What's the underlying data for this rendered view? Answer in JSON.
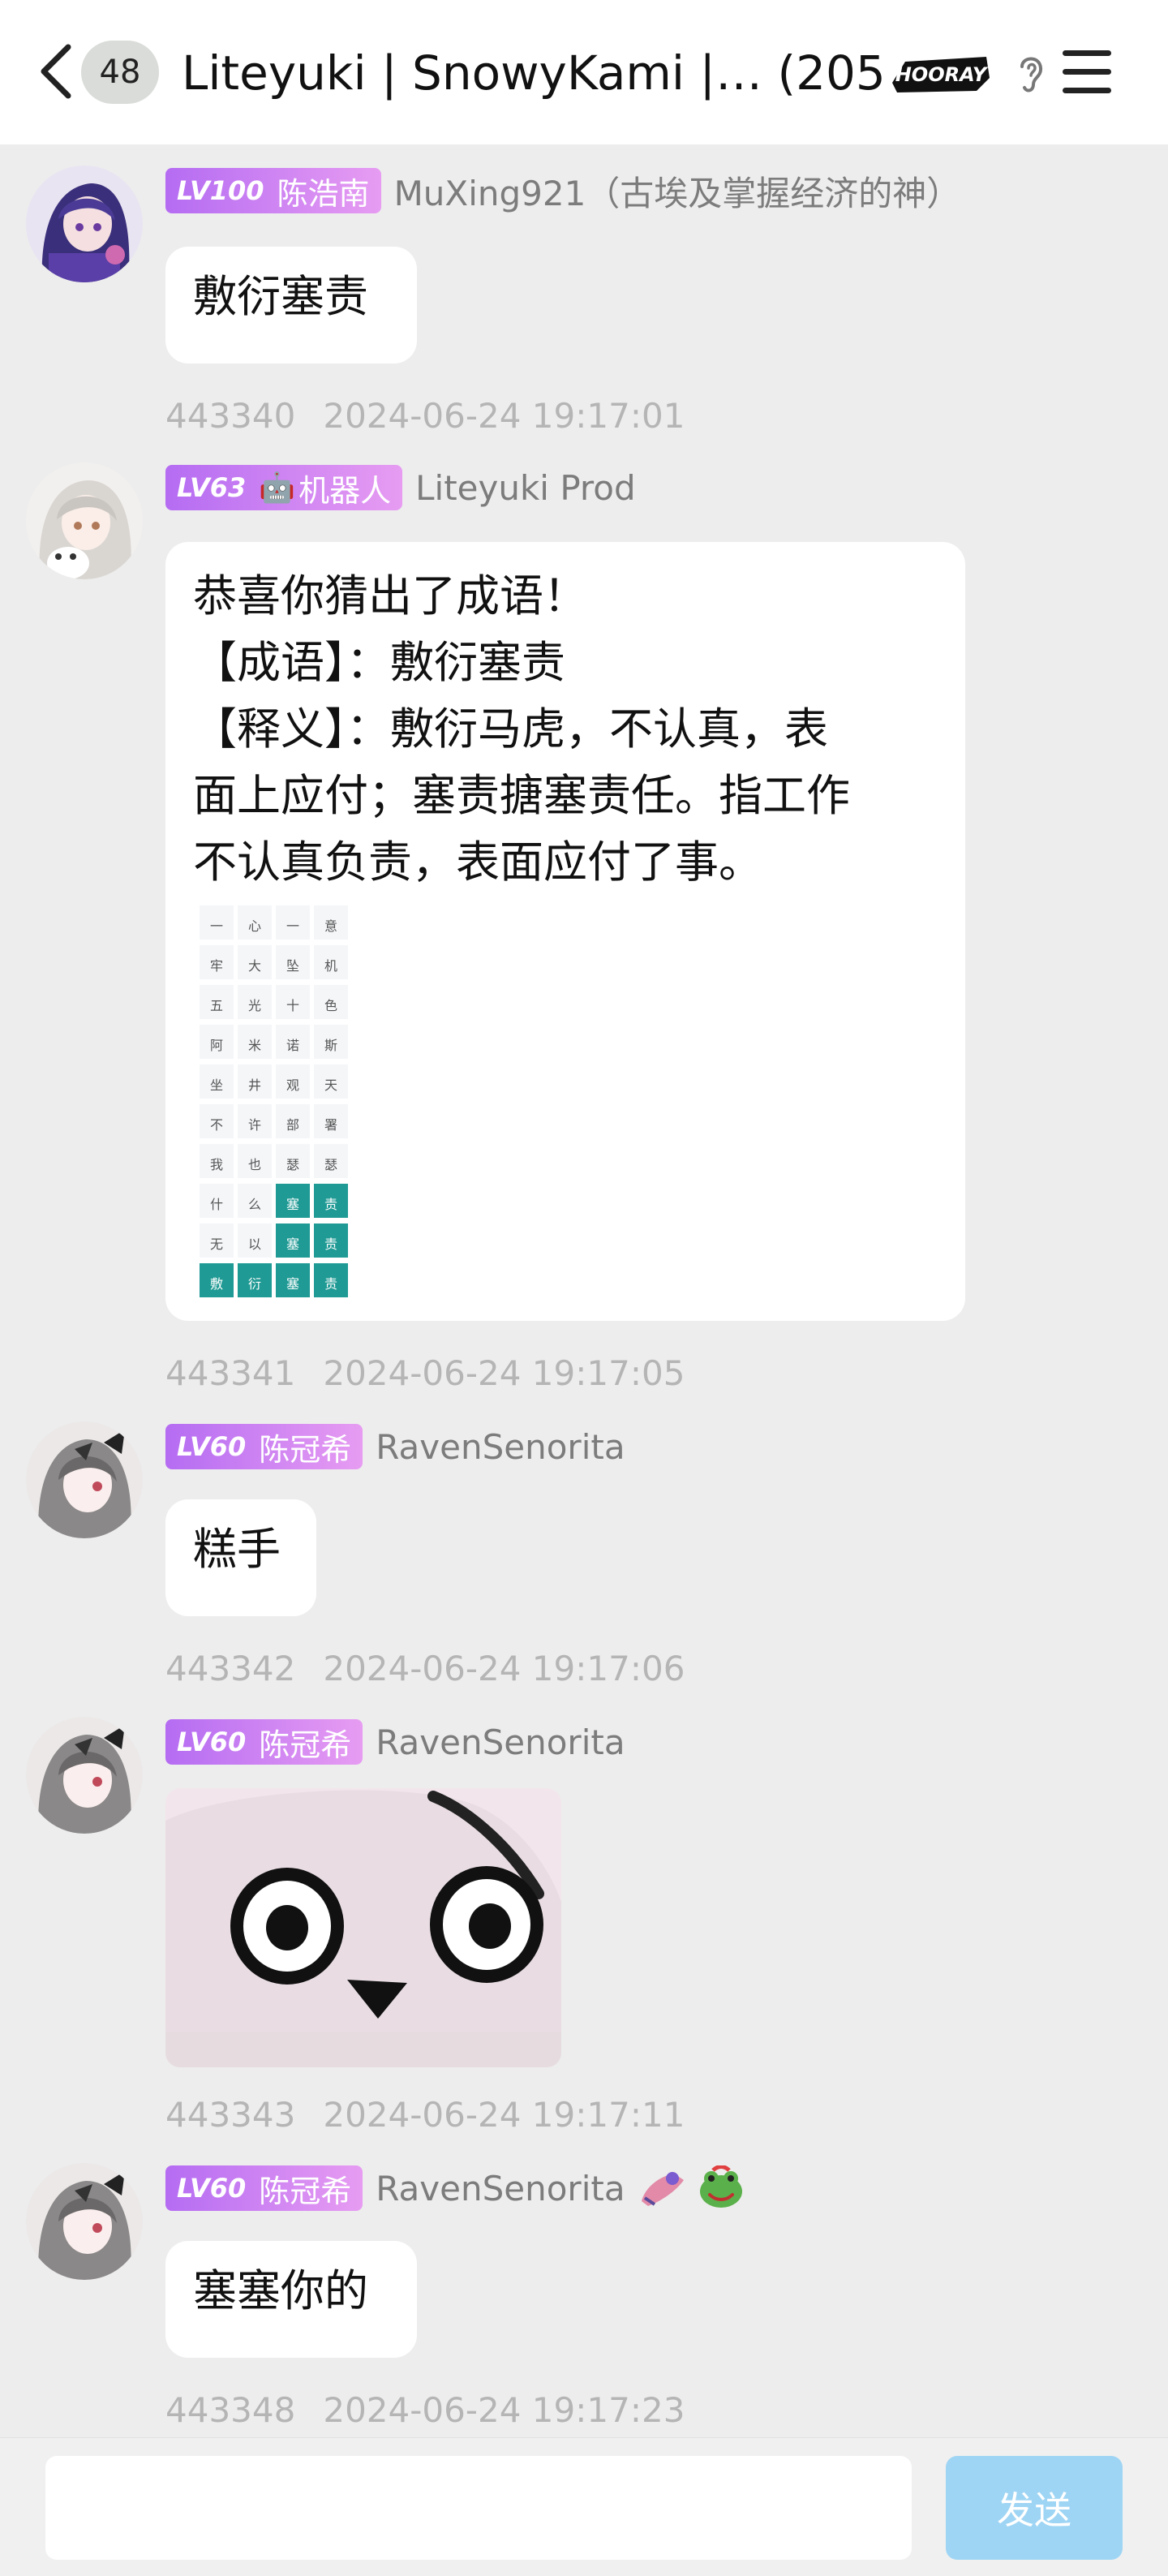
{
  "header": {
    "unread": "48",
    "title": "Liteyuki | SnowyKami |… (205)",
    "hooray_text": "HOORAY"
  },
  "messages": [
    {
      "level": "LV100",
      "badge": "陈浩南",
      "nick": "MuXing921（古埃及掌握经济的神）",
      "text": "敷衍塞责",
      "id": "443340",
      "time": "2024-06-24 19:17:01"
    },
    {
      "level": "LV63",
      "badge_icon": "🤖",
      "badge": "机器人",
      "nick": "Liteyuki Prod",
      "lines": [
        "恭喜你猜出了成语！",
        "【成语】：敷衍塞责",
        "【释义】：敷衍马虎，不认真，表",
        "面上应付；塞责搪塞责任。指工作",
        "不认真负责，表面应付了事。"
      ],
      "grid": [
        [
          "一",
          "心",
          "一",
          "意"
        ],
        [
          "牢",
          "大",
          "坠",
          "机"
        ],
        [
          "五",
          "光",
          "十",
          "色"
        ],
        [
          "阿",
          "米",
          "诺",
          "斯"
        ],
        [
          "坐",
          "井",
          "观",
          "天"
        ],
        [
          "不",
          "许",
          "部",
          "署"
        ],
        [
          "我",
          "也",
          "瑟",
          "瑟"
        ],
        [
          "什",
          "么",
          "塞",
          "责"
        ],
        [
          "无",
          "以",
          "塞",
          "责"
        ],
        [
          "敷",
          "衍",
          "塞",
          "责"
        ]
      ],
      "grid_hits": [
        [
          7,
          2
        ],
        [
          7,
          3
        ],
        [
          8,
          2
        ],
        [
          8,
          3
        ],
        [
          9,
          0
        ],
        [
          9,
          1
        ],
        [
          9,
          2
        ],
        [
          9,
          3
        ]
      ],
      "id": "443341",
      "time": "2024-06-24 19:17:05"
    },
    {
      "level": "LV60",
      "badge": "陈冠希",
      "nick": "RavenSenorita",
      "text": "糕手",
      "id": "443342",
      "time": "2024-06-24 19:17:06"
    },
    {
      "level": "LV60",
      "badge": "陈冠希",
      "nick": "RavenSenorita",
      "id": "443343",
      "time": "2024-06-24 19:17:11"
    },
    {
      "level": "LV60",
      "badge": "陈冠希",
      "nick": "RavenSenorita",
      "text": "塞塞你的",
      "id": "443348",
      "time": "2024-06-24 19:17:23"
    }
  ],
  "composer": {
    "placeholder": "",
    "send_label": "发送"
  },
  "colors": {
    "badge_start": "#b56cf2",
    "badge_end": "#e79cf2",
    "hit_cell": "#1f9a94",
    "send_button": "#9fd5f4",
    "background": "#ededed"
  }
}
